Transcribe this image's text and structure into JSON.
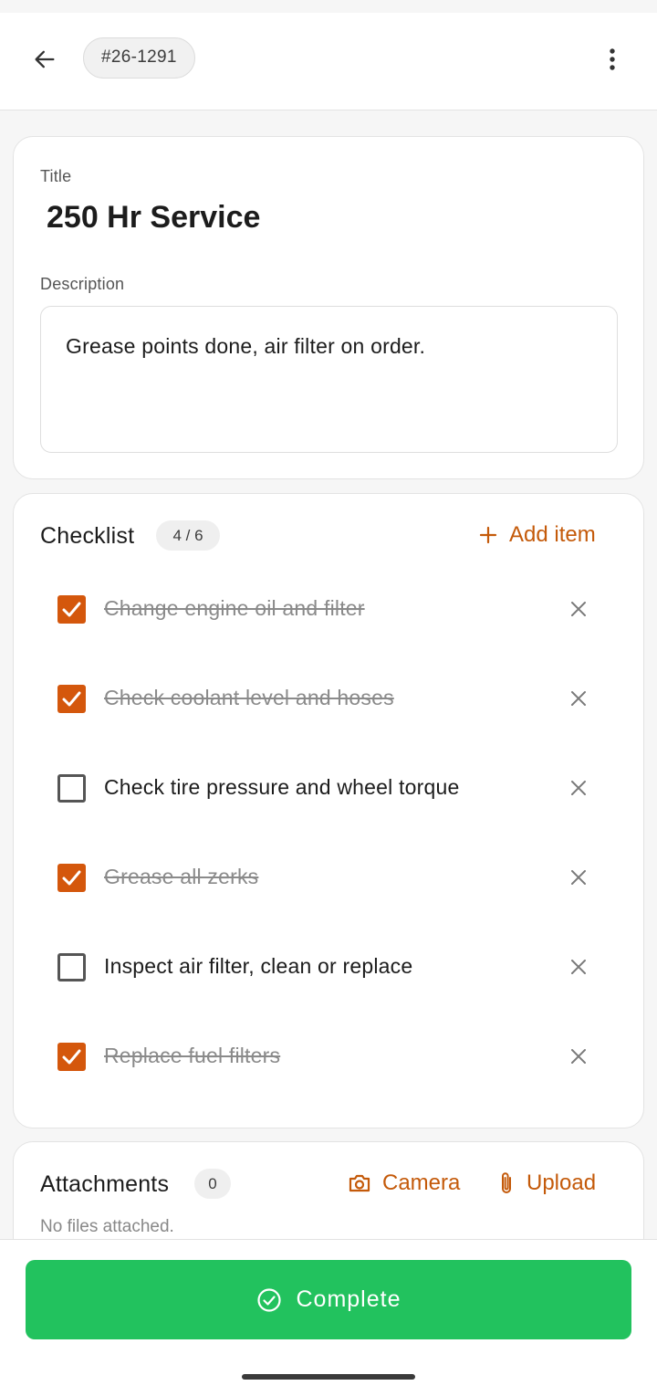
{
  "header": {
    "ticket_id": "#26-1291"
  },
  "details": {
    "title_label": "Title",
    "title_value": "250 Hr Service",
    "description_label": "Description",
    "description_value": "Grease points done, air filter on order."
  },
  "checklist": {
    "heading": "Checklist",
    "progress": "4 / 6",
    "add_label": "Add item",
    "items": [
      {
        "label": "Change engine oil and filter",
        "done": true
      },
      {
        "label": "Check coolant level and hoses",
        "done": true
      },
      {
        "label": "Check tire pressure and wheel torque",
        "done": false
      },
      {
        "label": "Grease all zerks",
        "done": true
      },
      {
        "label": "Inspect air filter, clean or replace",
        "done": false
      },
      {
        "label": "Replace fuel filters",
        "done": true
      }
    ]
  },
  "attachments": {
    "heading": "Attachments",
    "count": "0",
    "camera_label": "Camera",
    "upload_label": "Upload",
    "empty_text": "No files attached."
  },
  "footer": {
    "complete_label": "Complete"
  },
  "colors": {
    "accent": "#c45a0a",
    "checkbox": "#d4570c",
    "complete": "#22c25e"
  }
}
